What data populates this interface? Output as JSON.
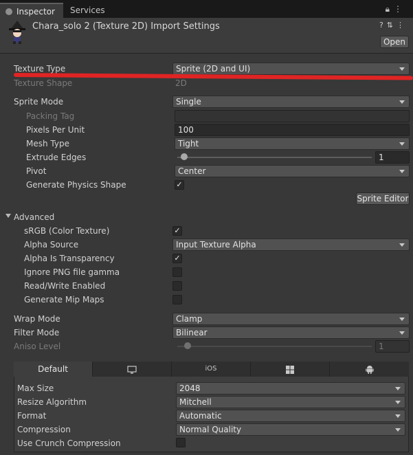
{
  "tabs": {
    "inspector": "Inspector",
    "services": "Services"
  },
  "header": {
    "title": "Chara_solo 2 (Texture 2D) Import Settings",
    "open_button": "Open"
  },
  "fields": {
    "texture_type": {
      "label": "Texture Type",
      "value": "Sprite (2D and UI)"
    },
    "texture_shape": {
      "label": "Texture Shape",
      "value": "2D"
    },
    "sprite_mode": {
      "label": "Sprite Mode",
      "value": "Single"
    },
    "packing_tag": {
      "label": "Packing Tag",
      "value": ""
    },
    "pixels_per_unit": {
      "label": "Pixels Per Unit",
      "value": "100"
    },
    "mesh_type": {
      "label": "Mesh Type",
      "value": "Tight"
    },
    "extrude_edges": {
      "label": "Extrude Edges",
      "value": "1",
      "fraction": 0.05
    },
    "pivot": {
      "label": "Pivot",
      "value": "Center"
    },
    "gen_physics": {
      "label": "Generate Physics Shape",
      "checked": true
    },
    "sprite_editor": "Sprite Editor"
  },
  "advanced": {
    "label": "Advanced",
    "srgb": {
      "label": "sRGB (Color Texture)",
      "checked": true
    },
    "alpha_source": {
      "label": "Alpha Source",
      "value": "Input Texture Alpha"
    },
    "alpha_transparency": {
      "label": "Alpha Is Transparency",
      "checked": true
    },
    "ignore_png_gamma": {
      "label": "Ignore PNG file gamma",
      "checked": false
    },
    "read_write": {
      "label": "Read/Write Enabled",
      "checked": false
    },
    "mip_maps": {
      "label": "Generate Mip Maps",
      "checked": false
    }
  },
  "wrap_mode": {
    "label": "Wrap Mode",
    "value": "Clamp"
  },
  "filter_mode": {
    "label": "Filter Mode",
    "value": "Bilinear"
  },
  "aniso_level": {
    "label": "Aniso Level",
    "value": "1"
  },
  "platform": {
    "tabs": [
      "Default",
      "",
      "iOS",
      "",
      ""
    ],
    "tab_icons": [
      "",
      "monitor-icon",
      "",
      "windows-icon",
      "android-icon"
    ],
    "max_size": {
      "label": "Max Size",
      "value": "2048"
    },
    "resize_algorithm": {
      "label": "Resize Algorithm",
      "value": "Mitchell"
    },
    "format": {
      "label": "Format",
      "value": "Automatic"
    },
    "compression": {
      "label": "Compression",
      "value": "Normal Quality"
    },
    "crunch": {
      "label": "Use Crunch Compression",
      "checked": false
    }
  },
  "colors": {
    "background": "#383838",
    "annotation_line": "#e02424"
  }
}
